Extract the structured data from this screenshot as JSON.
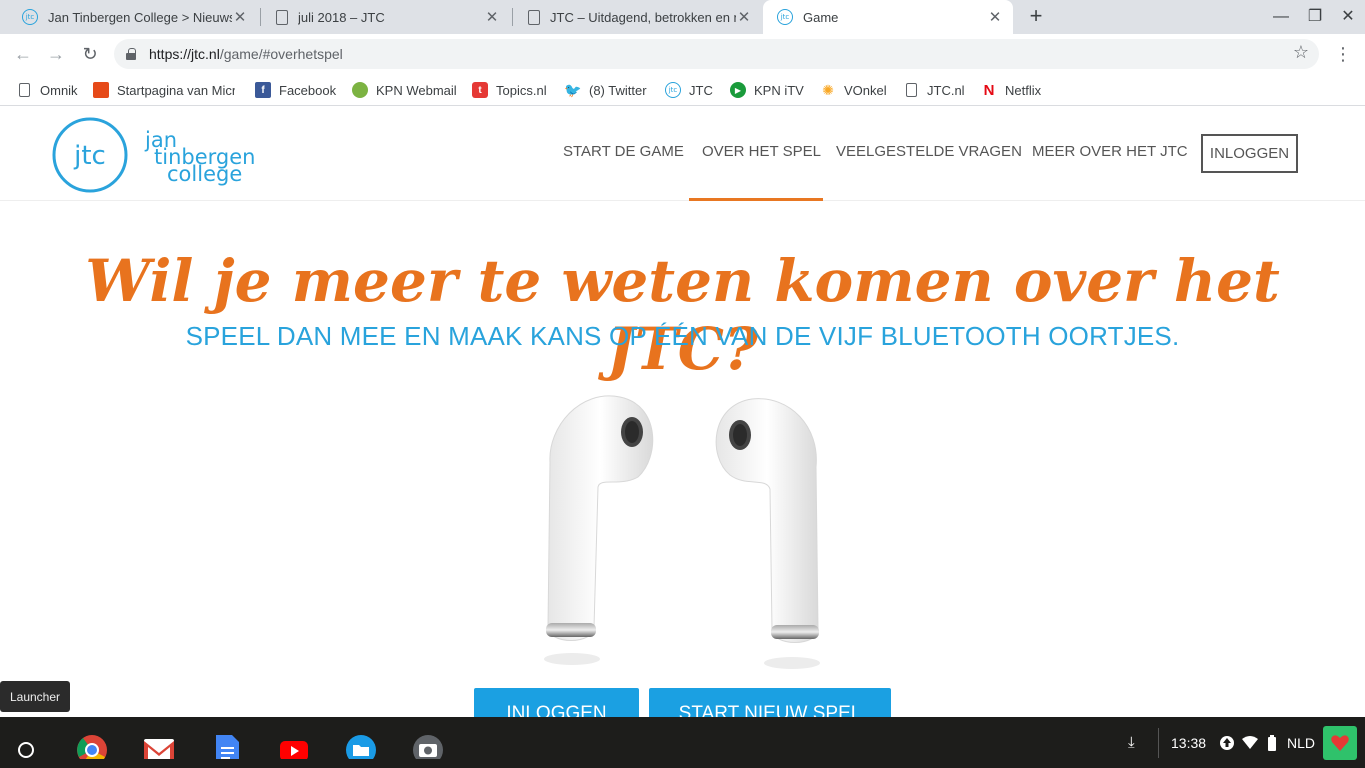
{
  "tabs": [
    {
      "title": "Jan Tinbergen College > Nieuws"
    },
    {
      "title": "juli 2018 – JTC"
    },
    {
      "title": "JTC – Uitdagend, betrokken en n"
    },
    {
      "title": "Game"
    }
  ],
  "toolbar": {
    "url_host": "https://jtc.nl",
    "url_path": "/game/#overhetspel"
  },
  "bookmarks": [
    {
      "label": "Omnik"
    },
    {
      "label": "Startpagina van Micr"
    },
    {
      "label": "Facebook"
    },
    {
      "label": "KPN Webmail"
    },
    {
      "label": "Topics.nl"
    },
    {
      "label": "(8) Twitter"
    },
    {
      "label": "JTC"
    },
    {
      "label": "KPN iTV"
    },
    {
      "label": "VOnkel"
    },
    {
      "label": "JTC.nl"
    },
    {
      "label": "Netflix"
    }
  ],
  "site": {
    "logo_mark": "jtc",
    "logo_line1": "jan",
    "logo_line2": "tinbergen",
    "logo_line3": "college",
    "nav": [
      "START DE GAME",
      "OVER HET SPEL",
      "VEELGESTELDE VRAGEN",
      "MEER OVER HET JTC"
    ],
    "login": "INLOGGEN",
    "headline": "Wil je meer te weten komen over het JTC?",
    "subline": "SPEEL DAN MEE EN MAAK KANS OP ÉÉN VAN DE VIJF BLUETOOTH OORTJES.",
    "cta_login": "INLOGGEN",
    "cta_start": "START NIEUW SPEL"
  },
  "shelf": {
    "tooltip": "Launcher",
    "time": "13:38",
    "lang": "NLD"
  },
  "colors": {
    "accent_orange": "#e87722",
    "accent_blue": "#29a3dc",
    "button_blue": "#1ba0e2"
  }
}
